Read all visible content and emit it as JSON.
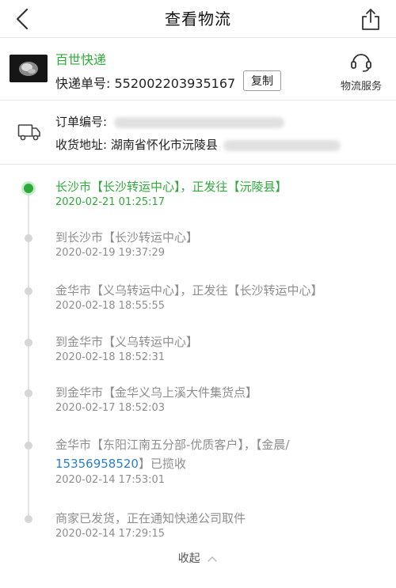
{
  "navbar": {
    "title": "查看物流"
  },
  "courier": {
    "name": "百世快递",
    "tracking_label": "快递单号:",
    "tracking_number": "552002203935167",
    "copy_label": "复制",
    "service_label": "物流服务"
  },
  "order": {
    "order_label": "订单编号:",
    "address_label": "收货地址:",
    "address_visible": "湖南省怀化市沅陵县"
  },
  "timeline": [
    {
      "text": "长沙市【长沙转运中心】，正发往【沅陵县】",
      "time": "2020-02-21 01:25:17",
      "active": true
    },
    {
      "text": "到长沙市【长沙转运中心】",
      "time": "2020-02-19 19:37:29"
    },
    {
      "text": "金华市【义乌转运中心】，正发往【长沙转运中心】",
      "time": "2020-02-18 18:55:55"
    },
    {
      "text": "到金华市【义乌转运中心】",
      "time": "2020-02-18 18:52:31"
    },
    {
      "text": "到金华市【金华义乌上溪大件集货点】",
      "time": "2020-02-17 18:52:03"
    },
    {
      "text_before": "金华市【东阳江南五分部-优质客户】，【金晨/",
      "phone": "15356958520",
      "text_after": "】已揽收",
      "time": "2020-02-14 17:53:01"
    },
    {
      "text": "商家已发货，正在通知快递公司取件",
      "time": "2020-02-14 17:29:15"
    }
  ],
  "footer": {
    "collapse_label": "收起"
  },
  "colors": {
    "accent": "#2eaa3a",
    "link": "#2a7fd0",
    "muted": "#8e8e8e"
  }
}
